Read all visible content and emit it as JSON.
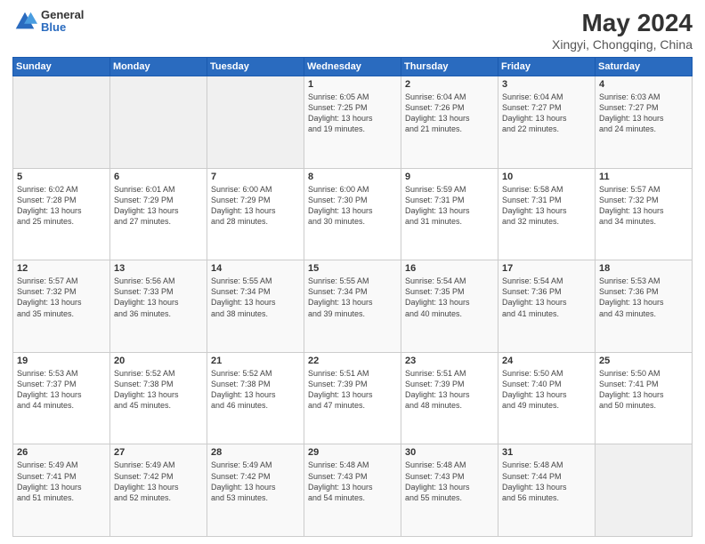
{
  "logo": {
    "general": "General",
    "blue": "Blue"
  },
  "title": "May 2024",
  "subtitle": "Xingyi, Chongqing, China",
  "days_of_week": [
    "Sunday",
    "Monday",
    "Tuesday",
    "Wednesday",
    "Thursday",
    "Friday",
    "Saturday"
  ],
  "weeks": [
    [
      {
        "day": "",
        "text": ""
      },
      {
        "day": "",
        "text": ""
      },
      {
        "day": "",
        "text": ""
      },
      {
        "day": "1",
        "text": "Sunrise: 6:05 AM\nSunset: 7:25 PM\nDaylight: 13 hours\nand 19 minutes."
      },
      {
        "day": "2",
        "text": "Sunrise: 6:04 AM\nSunset: 7:26 PM\nDaylight: 13 hours\nand 21 minutes."
      },
      {
        "day": "3",
        "text": "Sunrise: 6:04 AM\nSunset: 7:27 PM\nDaylight: 13 hours\nand 22 minutes."
      },
      {
        "day": "4",
        "text": "Sunrise: 6:03 AM\nSunset: 7:27 PM\nDaylight: 13 hours\nand 24 minutes."
      }
    ],
    [
      {
        "day": "5",
        "text": "Sunrise: 6:02 AM\nSunset: 7:28 PM\nDaylight: 13 hours\nand 25 minutes."
      },
      {
        "day": "6",
        "text": "Sunrise: 6:01 AM\nSunset: 7:29 PM\nDaylight: 13 hours\nand 27 minutes."
      },
      {
        "day": "7",
        "text": "Sunrise: 6:00 AM\nSunset: 7:29 PM\nDaylight: 13 hours\nand 28 minutes."
      },
      {
        "day": "8",
        "text": "Sunrise: 6:00 AM\nSunset: 7:30 PM\nDaylight: 13 hours\nand 30 minutes."
      },
      {
        "day": "9",
        "text": "Sunrise: 5:59 AM\nSunset: 7:31 PM\nDaylight: 13 hours\nand 31 minutes."
      },
      {
        "day": "10",
        "text": "Sunrise: 5:58 AM\nSunset: 7:31 PM\nDaylight: 13 hours\nand 32 minutes."
      },
      {
        "day": "11",
        "text": "Sunrise: 5:57 AM\nSunset: 7:32 PM\nDaylight: 13 hours\nand 34 minutes."
      }
    ],
    [
      {
        "day": "12",
        "text": "Sunrise: 5:57 AM\nSunset: 7:32 PM\nDaylight: 13 hours\nand 35 minutes."
      },
      {
        "day": "13",
        "text": "Sunrise: 5:56 AM\nSunset: 7:33 PM\nDaylight: 13 hours\nand 36 minutes."
      },
      {
        "day": "14",
        "text": "Sunrise: 5:55 AM\nSunset: 7:34 PM\nDaylight: 13 hours\nand 38 minutes."
      },
      {
        "day": "15",
        "text": "Sunrise: 5:55 AM\nSunset: 7:34 PM\nDaylight: 13 hours\nand 39 minutes."
      },
      {
        "day": "16",
        "text": "Sunrise: 5:54 AM\nSunset: 7:35 PM\nDaylight: 13 hours\nand 40 minutes."
      },
      {
        "day": "17",
        "text": "Sunrise: 5:54 AM\nSunset: 7:36 PM\nDaylight: 13 hours\nand 41 minutes."
      },
      {
        "day": "18",
        "text": "Sunrise: 5:53 AM\nSunset: 7:36 PM\nDaylight: 13 hours\nand 43 minutes."
      }
    ],
    [
      {
        "day": "19",
        "text": "Sunrise: 5:53 AM\nSunset: 7:37 PM\nDaylight: 13 hours\nand 44 minutes."
      },
      {
        "day": "20",
        "text": "Sunrise: 5:52 AM\nSunset: 7:38 PM\nDaylight: 13 hours\nand 45 minutes."
      },
      {
        "day": "21",
        "text": "Sunrise: 5:52 AM\nSunset: 7:38 PM\nDaylight: 13 hours\nand 46 minutes."
      },
      {
        "day": "22",
        "text": "Sunrise: 5:51 AM\nSunset: 7:39 PM\nDaylight: 13 hours\nand 47 minutes."
      },
      {
        "day": "23",
        "text": "Sunrise: 5:51 AM\nSunset: 7:39 PM\nDaylight: 13 hours\nand 48 minutes."
      },
      {
        "day": "24",
        "text": "Sunrise: 5:50 AM\nSunset: 7:40 PM\nDaylight: 13 hours\nand 49 minutes."
      },
      {
        "day": "25",
        "text": "Sunrise: 5:50 AM\nSunset: 7:41 PM\nDaylight: 13 hours\nand 50 minutes."
      }
    ],
    [
      {
        "day": "26",
        "text": "Sunrise: 5:49 AM\nSunset: 7:41 PM\nDaylight: 13 hours\nand 51 minutes."
      },
      {
        "day": "27",
        "text": "Sunrise: 5:49 AM\nSunset: 7:42 PM\nDaylight: 13 hours\nand 52 minutes."
      },
      {
        "day": "28",
        "text": "Sunrise: 5:49 AM\nSunset: 7:42 PM\nDaylight: 13 hours\nand 53 minutes."
      },
      {
        "day": "29",
        "text": "Sunrise: 5:48 AM\nSunset: 7:43 PM\nDaylight: 13 hours\nand 54 minutes."
      },
      {
        "day": "30",
        "text": "Sunrise: 5:48 AM\nSunset: 7:43 PM\nDaylight: 13 hours\nand 55 minutes."
      },
      {
        "day": "31",
        "text": "Sunrise: 5:48 AM\nSunset: 7:44 PM\nDaylight: 13 hours\nand 56 minutes."
      },
      {
        "day": "",
        "text": ""
      }
    ]
  ]
}
